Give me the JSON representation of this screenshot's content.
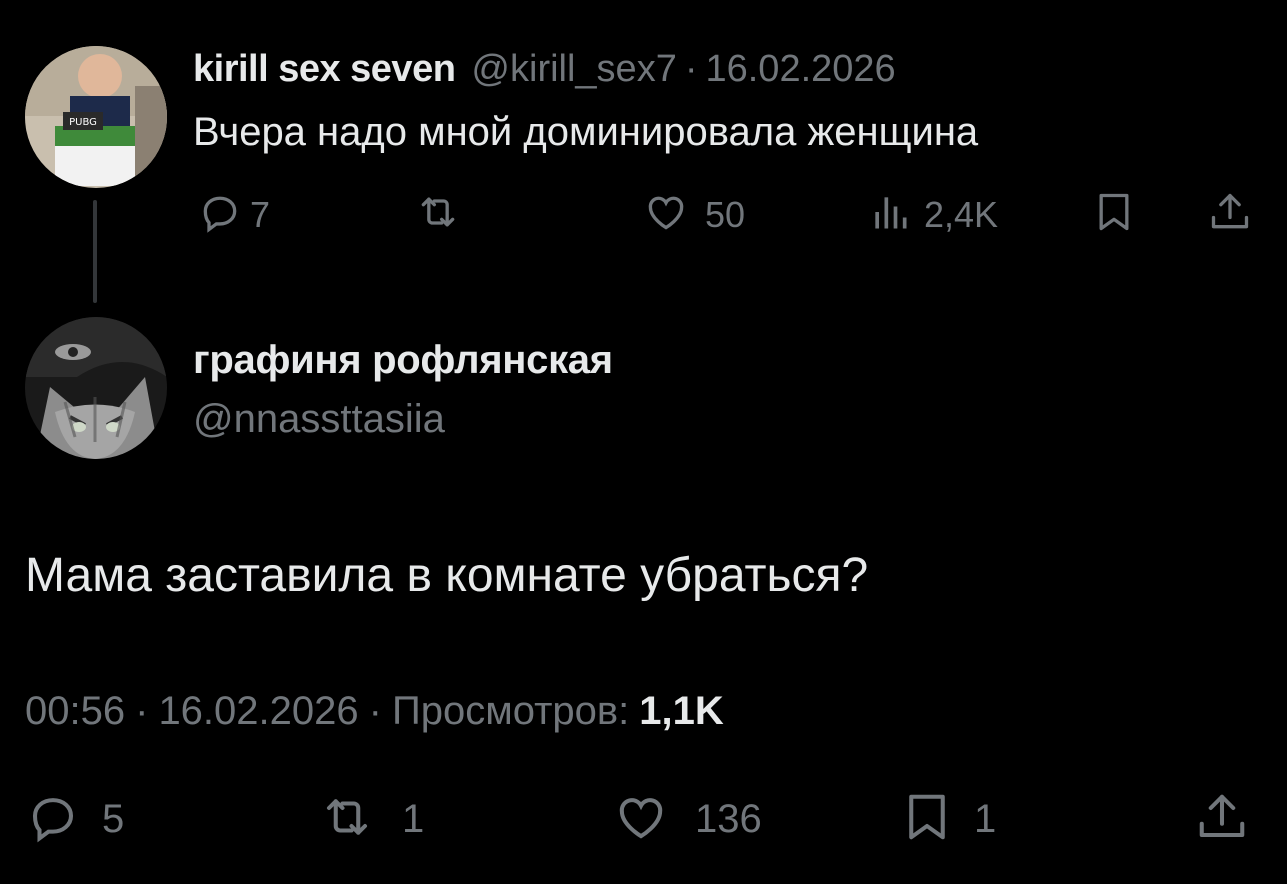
{
  "parent_tweet": {
    "display_name": "kirill sex seven",
    "handle": "@kirill_sex7",
    "separator": "·",
    "date": "16.02.2026",
    "text": "Вчера надо мной доминировала женщина",
    "actions": {
      "replies": "7",
      "retweets": "",
      "likes": "50",
      "views": "2,4K"
    },
    "icons": [
      "reply-icon",
      "retweet-icon",
      "like-icon",
      "views-icon",
      "bookmark-icon",
      "share-icon"
    ]
  },
  "reply_tweet": {
    "display_name": "графиня рофлянская",
    "handle": "@nnassttasiia",
    "text": "Мама заставила в комнате убраться?",
    "time": "00:56",
    "separator": "·",
    "date": "16.02.2026",
    "views_label": "Просмотров:",
    "views_count": "1,1K",
    "actions": {
      "replies": "5",
      "retweets": "1",
      "likes": "136",
      "bookmarks": "1"
    }
  },
  "colors": {
    "background": "#000000",
    "primary_text": "#e7e9ea",
    "secondary_text": "#71767b",
    "thread_line": "#333639"
  }
}
